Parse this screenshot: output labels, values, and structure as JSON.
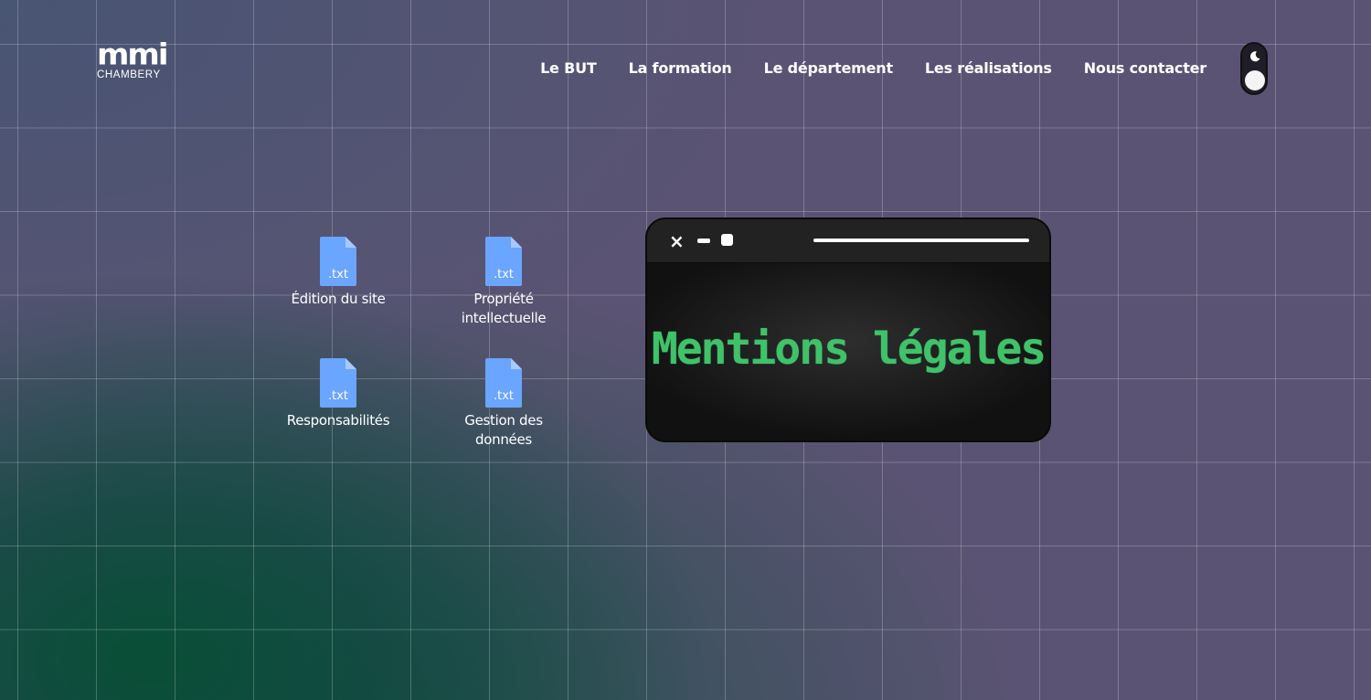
{
  "logo": {
    "mark": "mmi",
    "sub": "CHAMBERY"
  },
  "nav": {
    "items": [
      {
        "label": "Le BUT"
      },
      {
        "label": "La formation"
      },
      {
        "label": "Le département"
      },
      {
        "label": "Les réalisations"
      },
      {
        "label": "Nous contacter"
      }
    ]
  },
  "theme_toggle": {
    "icon": "moon-icon"
  },
  "files": [
    {
      "ext": ".txt",
      "label": "Édition du site"
    },
    {
      "ext": ".txt",
      "label": "Propriété intellectuelle"
    },
    {
      "ext": ".txt",
      "label": "Responsabilités"
    },
    {
      "ext": ".txt",
      "label": "Gestion des données"
    }
  ],
  "terminal": {
    "title": "Mentions légales",
    "close_icon": "×"
  },
  "colors": {
    "accent_green": "#3fc26a",
    "file_blue": "#6aa5ff",
    "background": "#5b5373"
  }
}
